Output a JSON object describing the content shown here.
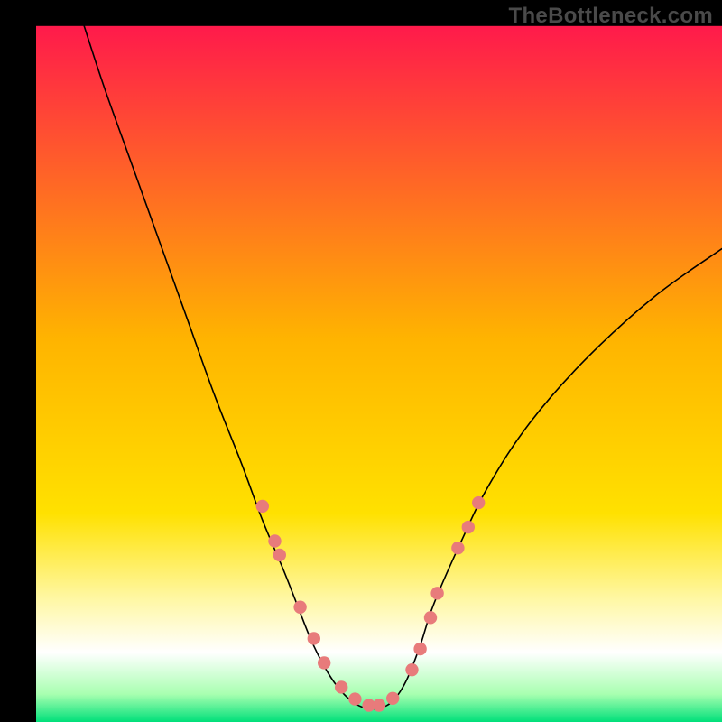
{
  "watermark": "TheBottleneck.com",
  "chart_data": {
    "type": "line",
    "title": "",
    "xlabel": "",
    "ylabel": "",
    "xlim": [
      0,
      100
    ],
    "ylim": [
      0,
      100
    ],
    "background_gradient": {
      "stops": [
        {
          "offset": 0.0,
          "color": "#ff1a4b"
        },
        {
          "offset": 0.45,
          "color": "#ffb400"
        },
        {
          "offset": 0.7,
          "color": "#ffe100"
        },
        {
          "offset": 0.82,
          "color": "#fff7a0"
        },
        {
          "offset": 0.9,
          "color": "#ffffff"
        },
        {
          "offset": 0.96,
          "color": "#a8ffb0"
        },
        {
          "offset": 1.0,
          "color": "#00e07a"
        }
      ]
    },
    "frame": {
      "outer": [
        0,
        0,
        100,
        100
      ],
      "plot_inset": [
        5,
        3.6,
        100,
        100
      ]
    },
    "series": [
      {
        "name": "bottleneck-curve",
        "color": "#000000",
        "stroke_width": 1.6,
        "x": [
          7,
          10,
          14,
          18,
          22,
          26,
          30,
          33,
          36,
          38,
          40,
          42,
          44,
          46,
          48,
          50,
          52,
          54,
          56,
          58,
          62,
          66,
          72,
          80,
          90,
          100
        ],
        "y": [
          100,
          91,
          80,
          69,
          58,
          47,
          37,
          29,
          22,
          17,
          12,
          8,
          5,
          3,
          2,
          2,
          3,
          6,
          11,
          17,
          26,
          34,
          43,
          52,
          61,
          68
        ]
      }
    ],
    "markers": {
      "color": "#e87b7b",
      "radius": 7.2,
      "points": [
        {
          "x": 33.0,
          "y": 31.0
        },
        {
          "x": 34.8,
          "y": 26.0
        },
        {
          "x": 35.5,
          "y": 24.0
        },
        {
          "x": 38.5,
          "y": 16.5
        },
        {
          "x": 40.5,
          "y": 12.0
        },
        {
          "x": 42.0,
          "y": 8.5
        },
        {
          "x": 44.5,
          "y": 5.0
        },
        {
          "x": 46.5,
          "y": 3.3
        },
        {
          "x": 48.5,
          "y": 2.4
        },
        {
          "x": 50.0,
          "y": 2.4
        },
        {
          "x": 52.0,
          "y": 3.4
        },
        {
          "x": 54.8,
          "y": 7.5
        },
        {
          "x": 56.0,
          "y": 10.5
        },
        {
          "x": 57.5,
          "y": 15.0
        },
        {
          "x": 58.5,
          "y": 18.5
        },
        {
          "x": 61.5,
          "y": 25.0
        },
        {
          "x": 63.0,
          "y": 28.0
        },
        {
          "x": 64.5,
          "y": 31.5
        }
      ]
    }
  }
}
